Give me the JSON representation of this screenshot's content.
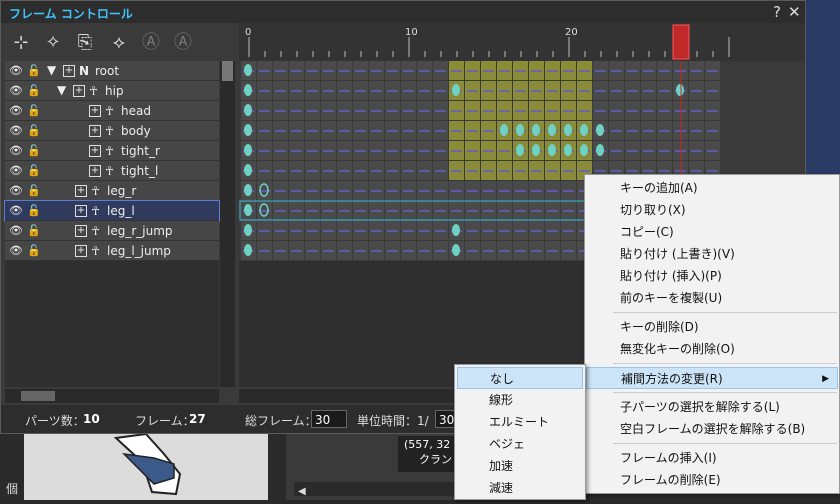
{
  "window": {
    "title": "フレーム コントロール",
    "help": "?",
    "close": "✕"
  },
  "toolbar": {
    "icons": [
      "add-parts-icon",
      "delete-parts-icon",
      "copy-frames-icon",
      "tool-icon",
      "undo-a-icon",
      "redo-a-icon"
    ]
  },
  "tree": {
    "rows": [
      {
        "label": "root",
        "type": "N",
        "level": 0
      },
      {
        "label": "hip",
        "type": "joint",
        "level": 1
      },
      {
        "label": "head",
        "type": "joint",
        "level": 2
      },
      {
        "label": "body",
        "type": "joint",
        "level": 2
      },
      {
        "label": "tight_r",
        "type": "joint",
        "level": 2
      },
      {
        "label": "tight_l",
        "type": "joint",
        "level": 2
      },
      {
        "label": "leg_r",
        "type": "joint",
        "level": 1
      },
      {
        "label": "leg_l",
        "type": "joint",
        "level": 1,
        "selected": true
      },
      {
        "label": "leg_r_jump",
        "type": "joint",
        "level": 1
      },
      {
        "label": "leg_l_jump",
        "type": "joint",
        "level": 1
      }
    ]
  },
  "timeline": {
    "ruler_labels": [
      "0",
      "10",
      "20"
    ],
    "frames": 30,
    "current_frame": 27,
    "keys": [
      [
        0
      ],
      [
        0,
        13,
        27
      ],
      [
        0
      ],
      [
        0,
        16,
        17,
        18,
        19,
        20,
        21,
        22
      ],
      [
        0,
        17,
        18,
        19,
        20,
        21,
        22
      ],
      [
        0
      ],
      [
        0,
        1
      ],
      [
        0,
        1
      ],
      [
        0,
        13
      ],
      [
        0,
        13
      ]
    ],
    "hollow_keys": [
      [
        6,
        1
      ],
      [
        7,
        1
      ]
    ]
  },
  "status": {
    "parts_label": "パーツ数：",
    "parts_value": "10",
    "frame_label": "フレーム：",
    "frame_value": "27",
    "total_label": "総フレーム：",
    "total_value": "30",
    "unit_label": "単位時間：1/",
    "unit_value": "30"
  },
  "below": {
    "coords": "(557, 32",
    "coords2": "クラン",
    "side_char": "個"
  },
  "context_menu": [
    {
      "label": "キーの追加(A)"
    },
    {
      "label": "切り取り(X)"
    },
    {
      "label": "コピー(C)"
    },
    {
      "label": "貼り付け (上書き)(V)"
    },
    {
      "label": "貼り付け (挿入)(P)"
    },
    {
      "label": "前のキーを複製(U)"
    },
    {
      "label": "キーの削除(D)"
    },
    {
      "label": "無変化キーの削除(O)"
    },
    {
      "label": "補間方法の変更(R)"
    },
    {
      "label": "子パーツの選択を解除する(L)"
    },
    {
      "label": "空白フレームの選択を解除する(B)"
    },
    {
      "label": "フレームの挿入(I)"
    },
    {
      "label": "フレームの削除(E)"
    }
  ],
  "submenu": [
    {
      "label": "なし"
    },
    {
      "label": "線形"
    },
    {
      "label": "エルミート"
    },
    {
      "label": "ベジェ"
    },
    {
      "label": "加速"
    },
    {
      "label": "減速"
    }
  ],
  "colors": {
    "accent": "#3fc6ff",
    "key": "#6fd1c4",
    "playhead": "#c0282a",
    "selection_fill": "#8a8c3a"
  }
}
